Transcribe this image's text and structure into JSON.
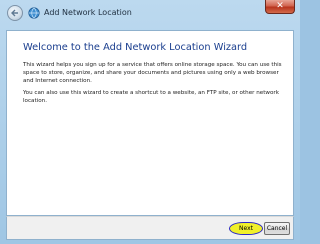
{
  "window": {
    "title": "Add Network Location",
    "close_glyph": "✕"
  },
  "main": {
    "heading": "Welcome to the Add Network Location Wizard",
    "paragraph1": "This wizard helps you sign up for a service that offers online storage space.  You can use this space to store, organize, and share your documents and pictures using only a web browser and Internet connection.",
    "paragraph2": "You can also use this wizard to create a shortcut to a website, an FTP site, or other network location."
  },
  "footer": {
    "next_label": "Next",
    "cancel_label": "Cancel"
  },
  "icons": {
    "back": "back-arrow-icon",
    "app": "globe-icon",
    "close": "close-icon"
  },
  "colors": {
    "heading": "#1a3e8e",
    "highlight": "#f0f02a",
    "highlight_outline": "#2d2ac2"
  }
}
